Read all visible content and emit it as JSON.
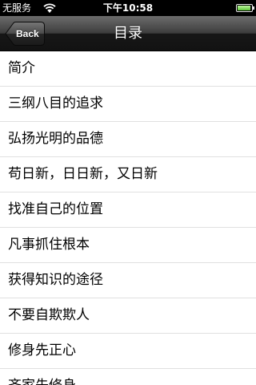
{
  "status_bar": {
    "carrier": "无服务",
    "time": "下午10:58",
    "wifi_icon": "wifi-icon",
    "battery_icon": "battery-icon"
  },
  "nav": {
    "back_label": "Back",
    "title": "目录"
  },
  "toc": {
    "items": [
      "简介",
      "三纲八目的追求",
      "弘扬光明的品德",
      "苟日新，日日新，又日新",
      "找准自己的位置",
      "凡事抓住根本",
      "获得知识的途径",
      "不要自欺欺人",
      "修身先正心",
      "齐家先修身"
    ]
  }
}
